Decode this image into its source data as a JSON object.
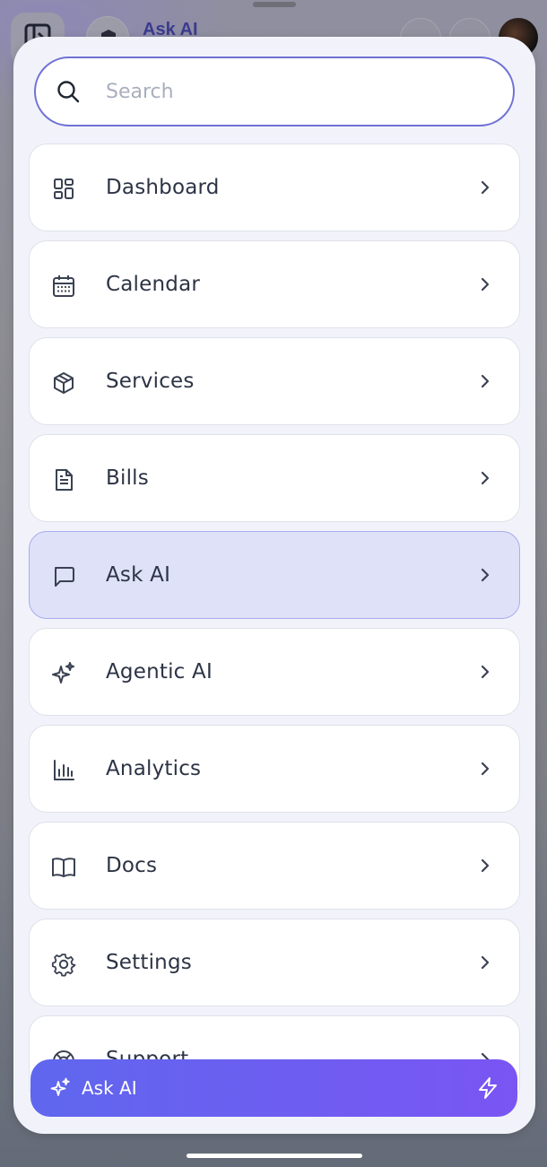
{
  "background": {
    "title": "Ask AI"
  },
  "search": {
    "placeholder": "Search",
    "value": ""
  },
  "menu": {
    "items": [
      {
        "label": "Dashboard",
        "icon": "dashboard-icon"
      },
      {
        "label": "Calendar",
        "icon": "calendar-icon"
      },
      {
        "label": "Services",
        "icon": "box-icon"
      },
      {
        "label": "Bills",
        "icon": "document-icon"
      },
      {
        "label": "Ask AI",
        "icon": "chat-icon",
        "active": true
      },
      {
        "label": "Agentic AI",
        "icon": "sparkles-icon"
      },
      {
        "label": "Analytics",
        "icon": "bar-chart-icon"
      },
      {
        "label": "Docs",
        "icon": "book-icon"
      },
      {
        "label": "Settings",
        "icon": "gear-icon"
      },
      {
        "label": "Support",
        "icon": "lifebuoy-icon"
      }
    ]
  },
  "cta": {
    "label": "Ask AI",
    "icon": "sparkles-icon",
    "trailing_icon": "bolt-icon"
  },
  "colors": {
    "accent": "#6f71d6",
    "active_bg": "#dee1f8",
    "cta_start": "#5f67ee",
    "cta_end": "#7a55f3"
  }
}
